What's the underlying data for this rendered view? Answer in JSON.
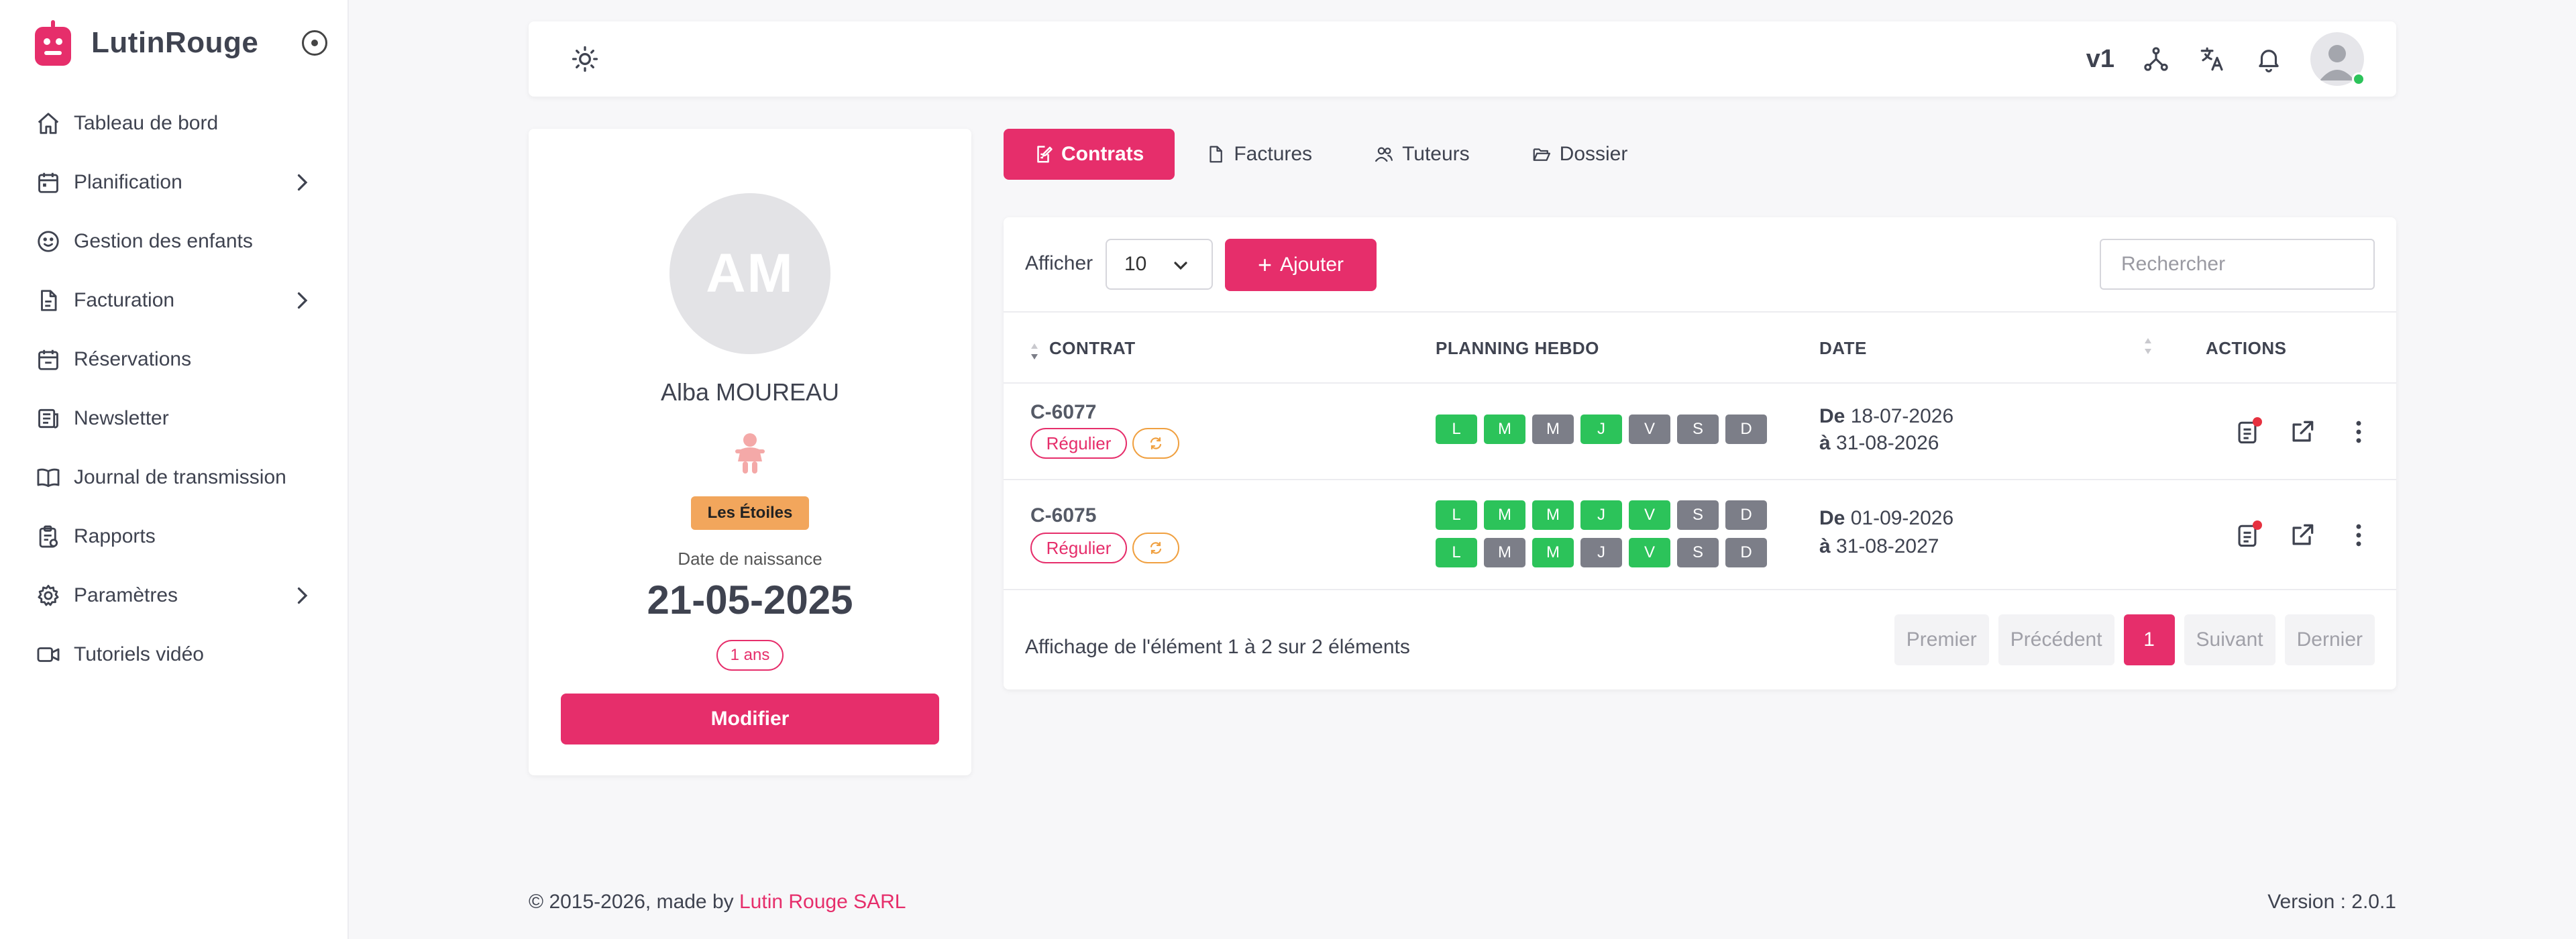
{
  "app": {
    "name": "LutinRouge"
  },
  "sidebar": {
    "items": [
      {
        "label": "Tableau de bord",
        "icon": "home-icon"
      },
      {
        "label": "Planification",
        "icon": "calendar-icon",
        "has_submenu": true
      },
      {
        "label": "Gestion des enfants",
        "icon": "smiley-icon"
      },
      {
        "label": "Facturation",
        "icon": "invoice-icon",
        "has_submenu": true
      },
      {
        "label": "Réservations",
        "icon": "calendar-check-icon"
      },
      {
        "label": "Newsletter",
        "icon": "newspaper-icon"
      },
      {
        "label": "Journal de transmission",
        "icon": "book-icon"
      },
      {
        "label": "Rapports",
        "icon": "clipboard-icon"
      },
      {
        "label": "Paramètres",
        "icon": "gear-icon",
        "has_submenu": true
      },
      {
        "label": "Tutoriels vidéo",
        "icon": "video-icon"
      }
    ]
  },
  "topbar": {
    "version": "v1"
  },
  "profile": {
    "initials": "AM",
    "name": "Alba MOUREAU",
    "group": "Les Étoiles",
    "dob_label": "Date de naissance",
    "dob": "21-05-2025",
    "age": "1 ans",
    "edit_label": "Modifier"
  },
  "tabs": [
    {
      "label": "Contrats",
      "active": true
    },
    {
      "label": "Factures",
      "active": false
    },
    {
      "label": "Tuteurs",
      "active": false
    },
    {
      "label": "Dossier",
      "active": false
    }
  ],
  "table": {
    "show_label": "Afficher",
    "page_size": "10",
    "add_label": "Ajouter",
    "search_placeholder": "Rechercher",
    "headers": {
      "contract": "CONTRAT",
      "planning": "PLANNING HEBDO",
      "date": "DATE",
      "actions": "ACTIONS"
    },
    "rows": [
      {
        "id": "C-6077",
        "type": "Régulier",
        "weeks": [
          [
            "L",
            "M",
            "M",
            "J",
            "V",
            "S",
            "D"
          ]
        ],
        "weeks_active": [
          [
            true,
            true,
            false,
            true,
            false,
            false,
            false
          ]
        ],
        "date_from_prefix": "De",
        "date_from": "18-07-2026",
        "date_to_prefix": "à",
        "date_to": "31-08-2026"
      },
      {
        "id": "C-6075",
        "type": "Régulier",
        "weeks": [
          [
            "L",
            "M",
            "M",
            "J",
            "V",
            "S",
            "D"
          ],
          [
            "L",
            "M",
            "M",
            "J",
            "V",
            "S",
            "D"
          ]
        ],
        "weeks_active": [
          [
            true,
            true,
            true,
            true,
            true,
            false,
            false
          ],
          [
            true,
            false,
            true,
            false,
            true,
            false,
            false
          ]
        ],
        "date_from_prefix": "De",
        "date_from": "01-09-2026",
        "date_to_prefix": "à",
        "date_to": "31-08-2027"
      }
    ],
    "info": "Affichage de l'élément 1 à 2 sur 2 éléments",
    "pager": {
      "first": "Premier",
      "prev": "Précédent",
      "current": "1",
      "next": "Suivant",
      "last": "Dernier"
    }
  },
  "footer": {
    "copyright_prefix": "© 2015-2026, made by",
    "company": "Lutin Rouge SARL",
    "version": "Version : 2.0.1"
  },
  "colors": {
    "accent": "#e62e6b",
    "day_active": "#2cc35a",
    "day_inactive": "#7c7e88",
    "group_badge": "#f2a65c",
    "renew_badge": "#f0a040"
  }
}
